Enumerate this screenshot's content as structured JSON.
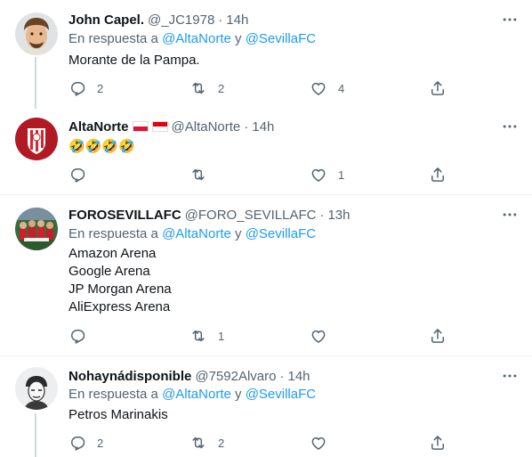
{
  "tweets": [
    {
      "name": "John Capel.",
      "handle": "@_JC1978",
      "time": "14h",
      "reply_prefix": "En respuesta a ",
      "reply_mention_1": "@AltaNorte",
      "reply_join": " y ",
      "reply_mention_2": "@SevillaFC",
      "lines": [
        "Morante de la Pampa."
      ],
      "replies": "2",
      "retweets": "2",
      "likes": "4"
    },
    {
      "name": "AltaNorte",
      "handle": "@AltaNorte",
      "time": "14h",
      "name_flags": [
        "flag-poland",
        "flag-indonesia"
      ],
      "lines": [
        "🤣🤣🤣🤣"
      ],
      "replies": "",
      "retweets": "",
      "likes": "1"
    },
    {
      "name": "FOROSEVILLAFC",
      "handle": "@FORO_SEVILLAFC",
      "time": "13h",
      "reply_prefix": "En respuesta a ",
      "reply_mention_1": "@AltaNorte",
      "reply_join": " y ",
      "reply_mention_2": "@SevillaFC",
      "lines": [
        "Amazon Arena",
        "Google Arena",
        "JP Morgan Arena",
        "AliExpress Arena"
      ],
      "replies": "",
      "retweets": "1",
      "likes": ""
    },
    {
      "name": "Nohaynádisponible",
      "handle": "@7592Alvaro",
      "time": "14h",
      "reply_prefix": "En respuesta a ",
      "reply_mention_1": "@AltaNorte",
      "reply_join": " y ",
      "reply_mention_2": "@SevillaFC",
      "lines": [
        "Petros Marinakis"
      ],
      "replies": "2",
      "retweets": "2",
      "likes": ""
    }
  ],
  "separator": "·",
  "icons": {
    "more": "more-horizontal-icon",
    "reply": "reply-bubble-icon",
    "retweet": "retweet-icon",
    "like": "heart-icon",
    "share": "share-icon"
  },
  "colors": {
    "text": "#0f1419",
    "muted": "#536471",
    "link": "#1d9bf0",
    "thread_line": "#cfd9de",
    "divider": "#eff3f4"
  }
}
